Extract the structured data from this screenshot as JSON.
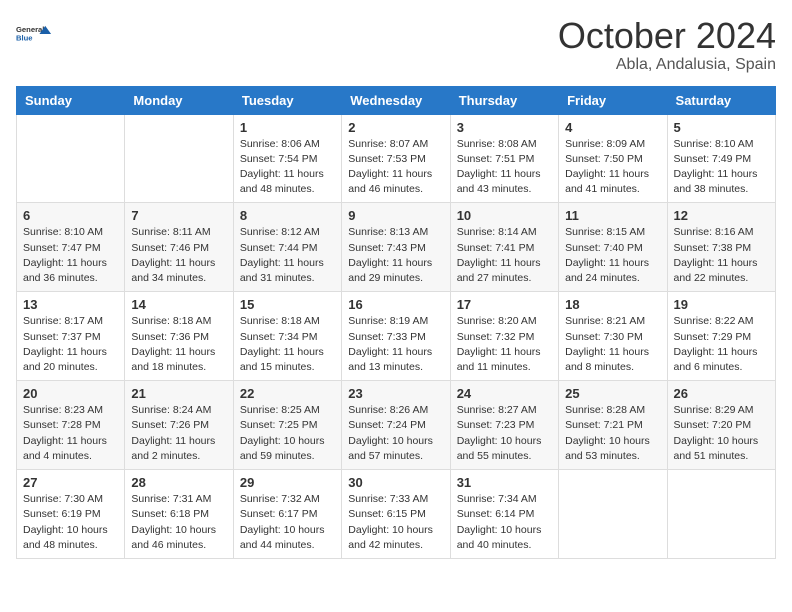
{
  "logo": {
    "line1": "General",
    "line2": "Blue"
  },
  "title": "October 2024",
  "subtitle": "Abla, Andalusia, Spain",
  "days_of_week": [
    "Sunday",
    "Monday",
    "Tuesday",
    "Wednesday",
    "Thursday",
    "Friday",
    "Saturday"
  ],
  "weeks": [
    [
      {
        "day": null
      },
      {
        "day": null
      },
      {
        "day": "1",
        "sunrise": "Sunrise: 8:06 AM",
        "sunset": "Sunset: 7:54 PM",
        "daylight": "Daylight: 11 hours and 48 minutes."
      },
      {
        "day": "2",
        "sunrise": "Sunrise: 8:07 AM",
        "sunset": "Sunset: 7:53 PM",
        "daylight": "Daylight: 11 hours and 46 minutes."
      },
      {
        "day": "3",
        "sunrise": "Sunrise: 8:08 AM",
        "sunset": "Sunset: 7:51 PM",
        "daylight": "Daylight: 11 hours and 43 minutes."
      },
      {
        "day": "4",
        "sunrise": "Sunrise: 8:09 AM",
        "sunset": "Sunset: 7:50 PM",
        "daylight": "Daylight: 11 hours and 41 minutes."
      },
      {
        "day": "5",
        "sunrise": "Sunrise: 8:10 AM",
        "sunset": "Sunset: 7:49 PM",
        "daylight": "Daylight: 11 hours and 38 minutes."
      }
    ],
    [
      {
        "day": "6",
        "sunrise": "Sunrise: 8:10 AM",
        "sunset": "Sunset: 7:47 PM",
        "daylight": "Daylight: 11 hours and 36 minutes."
      },
      {
        "day": "7",
        "sunrise": "Sunrise: 8:11 AM",
        "sunset": "Sunset: 7:46 PM",
        "daylight": "Daylight: 11 hours and 34 minutes."
      },
      {
        "day": "8",
        "sunrise": "Sunrise: 8:12 AM",
        "sunset": "Sunset: 7:44 PM",
        "daylight": "Daylight: 11 hours and 31 minutes."
      },
      {
        "day": "9",
        "sunrise": "Sunrise: 8:13 AM",
        "sunset": "Sunset: 7:43 PM",
        "daylight": "Daylight: 11 hours and 29 minutes."
      },
      {
        "day": "10",
        "sunrise": "Sunrise: 8:14 AM",
        "sunset": "Sunset: 7:41 PM",
        "daylight": "Daylight: 11 hours and 27 minutes."
      },
      {
        "day": "11",
        "sunrise": "Sunrise: 8:15 AM",
        "sunset": "Sunset: 7:40 PM",
        "daylight": "Daylight: 11 hours and 24 minutes."
      },
      {
        "day": "12",
        "sunrise": "Sunrise: 8:16 AM",
        "sunset": "Sunset: 7:38 PM",
        "daylight": "Daylight: 11 hours and 22 minutes."
      }
    ],
    [
      {
        "day": "13",
        "sunrise": "Sunrise: 8:17 AM",
        "sunset": "Sunset: 7:37 PM",
        "daylight": "Daylight: 11 hours and 20 minutes."
      },
      {
        "day": "14",
        "sunrise": "Sunrise: 8:18 AM",
        "sunset": "Sunset: 7:36 PM",
        "daylight": "Daylight: 11 hours and 18 minutes."
      },
      {
        "day": "15",
        "sunrise": "Sunrise: 8:18 AM",
        "sunset": "Sunset: 7:34 PM",
        "daylight": "Daylight: 11 hours and 15 minutes."
      },
      {
        "day": "16",
        "sunrise": "Sunrise: 8:19 AM",
        "sunset": "Sunset: 7:33 PM",
        "daylight": "Daylight: 11 hours and 13 minutes."
      },
      {
        "day": "17",
        "sunrise": "Sunrise: 8:20 AM",
        "sunset": "Sunset: 7:32 PM",
        "daylight": "Daylight: 11 hours and 11 minutes."
      },
      {
        "day": "18",
        "sunrise": "Sunrise: 8:21 AM",
        "sunset": "Sunset: 7:30 PM",
        "daylight": "Daylight: 11 hours and 8 minutes."
      },
      {
        "day": "19",
        "sunrise": "Sunrise: 8:22 AM",
        "sunset": "Sunset: 7:29 PM",
        "daylight": "Daylight: 11 hours and 6 minutes."
      }
    ],
    [
      {
        "day": "20",
        "sunrise": "Sunrise: 8:23 AM",
        "sunset": "Sunset: 7:28 PM",
        "daylight": "Daylight: 11 hours and 4 minutes."
      },
      {
        "day": "21",
        "sunrise": "Sunrise: 8:24 AM",
        "sunset": "Sunset: 7:26 PM",
        "daylight": "Daylight: 11 hours and 2 minutes."
      },
      {
        "day": "22",
        "sunrise": "Sunrise: 8:25 AM",
        "sunset": "Sunset: 7:25 PM",
        "daylight": "Daylight: 10 hours and 59 minutes."
      },
      {
        "day": "23",
        "sunrise": "Sunrise: 8:26 AM",
        "sunset": "Sunset: 7:24 PM",
        "daylight": "Daylight: 10 hours and 57 minutes."
      },
      {
        "day": "24",
        "sunrise": "Sunrise: 8:27 AM",
        "sunset": "Sunset: 7:23 PM",
        "daylight": "Daylight: 10 hours and 55 minutes."
      },
      {
        "day": "25",
        "sunrise": "Sunrise: 8:28 AM",
        "sunset": "Sunset: 7:21 PM",
        "daylight": "Daylight: 10 hours and 53 minutes."
      },
      {
        "day": "26",
        "sunrise": "Sunrise: 8:29 AM",
        "sunset": "Sunset: 7:20 PM",
        "daylight": "Daylight: 10 hours and 51 minutes."
      }
    ],
    [
      {
        "day": "27",
        "sunrise": "Sunrise: 7:30 AM",
        "sunset": "Sunset: 6:19 PM",
        "daylight": "Daylight: 10 hours and 48 minutes."
      },
      {
        "day": "28",
        "sunrise": "Sunrise: 7:31 AM",
        "sunset": "Sunset: 6:18 PM",
        "daylight": "Daylight: 10 hours and 46 minutes."
      },
      {
        "day": "29",
        "sunrise": "Sunrise: 7:32 AM",
        "sunset": "Sunset: 6:17 PM",
        "daylight": "Daylight: 10 hours and 44 minutes."
      },
      {
        "day": "30",
        "sunrise": "Sunrise: 7:33 AM",
        "sunset": "Sunset: 6:15 PM",
        "daylight": "Daylight: 10 hours and 42 minutes."
      },
      {
        "day": "31",
        "sunrise": "Sunrise: 7:34 AM",
        "sunset": "Sunset: 6:14 PM",
        "daylight": "Daylight: 10 hours and 40 minutes."
      },
      {
        "day": null
      },
      {
        "day": null
      }
    ]
  ]
}
